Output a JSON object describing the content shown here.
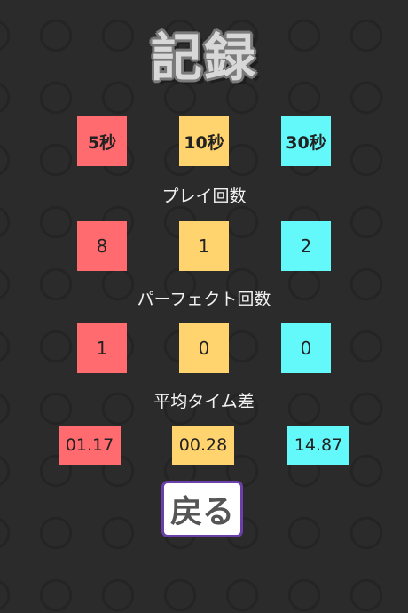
{
  "title": "記録",
  "modes": [
    "5秒",
    "10秒",
    "30秒"
  ],
  "play_count": {
    "label": "プレイ回数",
    "values": [
      "8",
      "1",
      "2"
    ]
  },
  "perfect_count": {
    "label": "パーフェクト回数",
    "values": [
      "1",
      "0",
      "0"
    ]
  },
  "avg_time_diff": {
    "label": "平均タイム差",
    "values": [
      "01.17",
      "00.28",
      "14.87"
    ]
  },
  "back_button": "戻る",
  "colors": {
    "mode_5s": "#ff6b6e",
    "mode_10s": "#ffd36e",
    "mode_30s": "#63f9fb",
    "background": "#2b2b2b",
    "button_border": "#6b3fa8"
  },
  "background_icon": "clock-icon"
}
